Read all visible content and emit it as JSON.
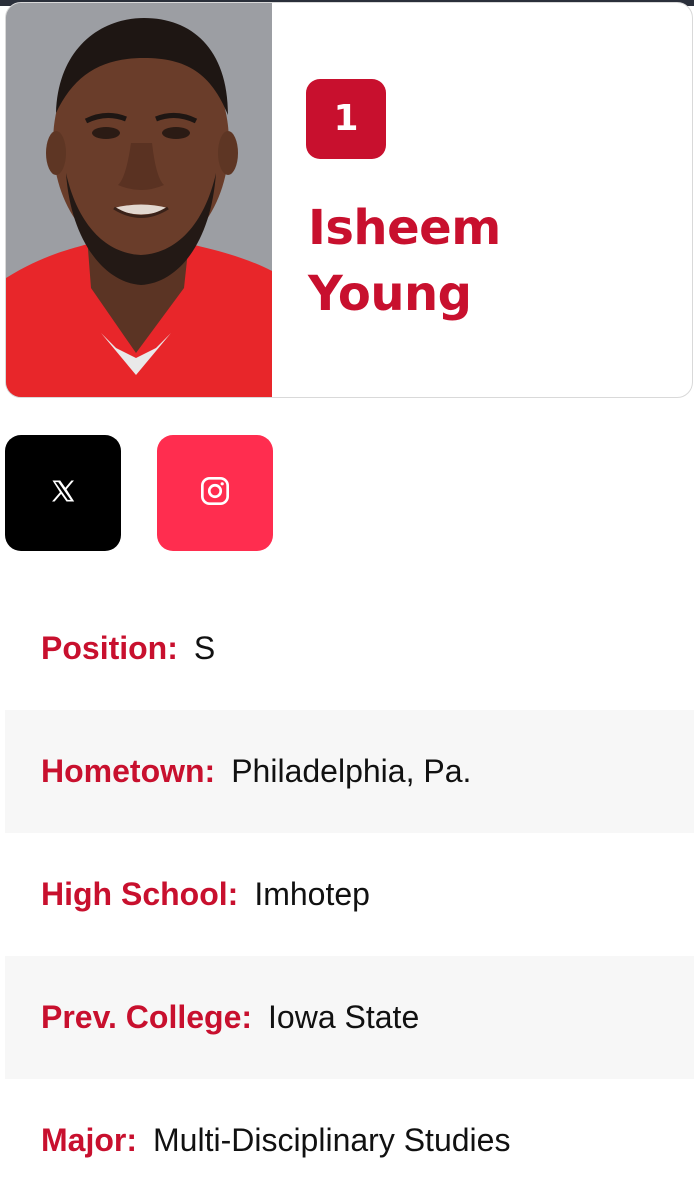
{
  "player": {
    "number": "1",
    "name": "Isheem Young",
    "photo_alt": "Isheem Young headshot"
  },
  "social": [
    {
      "name": "x-icon",
      "network": "X"
    },
    {
      "name": "instagram-icon",
      "network": "Instagram"
    }
  ],
  "info": [
    {
      "label": "Position:",
      "value": "S"
    },
    {
      "label": "Hometown:",
      "value": "Philadelphia, Pa."
    },
    {
      "label": "High School:",
      "value": "Imhotep"
    },
    {
      "label": "Prev. College:",
      "value": "Iowa State"
    },
    {
      "label": "Major:",
      "value": "Multi-Disciplinary Studies"
    }
  ],
  "colors": {
    "accent": "#c8102e",
    "x_button": "#000000",
    "instagram_button": "#ff2d4f",
    "row_alt": "#f7f7f7"
  }
}
